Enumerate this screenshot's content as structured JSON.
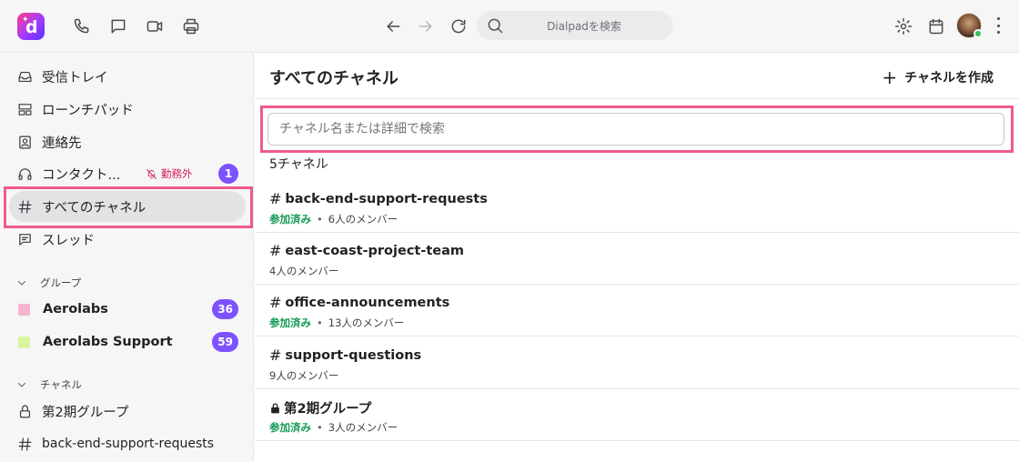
{
  "topbar": {
    "search_placeholder": "Dialpadを検索",
    "icons": [
      "phone-icon",
      "chat-icon",
      "video-icon",
      "printer-icon",
      "back-icon",
      "forward-icon",
      "refresh-icon",
      "search-icon",
      "gear-icon",
      "calendar-icon",
      "more-icon"
    ]
  },
  "sidebar": {
    "items": [
      {
        "label": "受信トレイ",
        "icon": "inbox-icon"
      },
      {
        "label": "ローンチパッド",
        "icon": "launchpad-icon"
      },
      {
        "label": "連絡先",
        "icon": "contacts-icon"
      },
      {
        "label": "コンタクト...",
        "icon": "headset-icon",
        "status": "勤務外",
        "badge": "1"
      },
      {
        "label": "すべてのチャネル",
        "icon": "hash-icon"
      },
      {
        "label": "スレッド",
        "icon": "threads-icon"
      }
    ],
    "groups_header": "グループ",
    "groups": [
      {
        "label": "Aerolabs",
        "badge": "36",
        "color": "#f7b3cf"
      },
      {
        "label": "Aerolabs Support",
        "badge": "59",
        "color": "#d8f5a2"
      }
    ],
    "channels_header": "チャネル",
    "channels": [
      {
        "label": "第2期グループ",
        "icon": "lock-icon"
      },
      {
        "label": "back-end-support-requests",
        "icon": "hash-icon"
      }
    ]
  },
  "main": {
    "title": "すべてのチャネル",
    "create_label": "チャネルを作成",
    "filter_placeholder": "チャネル名または詳細で検索",
    "count_label": "5チャネル",
    "joined_label": "参加済み",
    "channels": [
      {
        "name": "back-end-support-requests",
        "joined": true,
        "members": "6人のメンバー",
        "private": false
      },
      {
        "name": "east-coast-project-team",
        "joined": false,
        "members": "4人のメンバー",
        "private": false
      },
      {
        "name": "office-announcements",
        "joined": true,
        "members": "13人のメンバー",
        "private": false
      },
      {
        "name": "support-questions",
        "joined": false,
        "members": "9人のメンバー",
        "private": false
      },
      {
        "name": "第2期グループ",
        "joined": true,
        "members": "3人のメンバー",
        "private": true
      }
    ]
  },
  "colors": {
    "accent_badge": "#7c52ff",
    "highlight": "#ef5a8c",
    "joined": "#159a54",
    "offduty": "#d1245b"
  }
}
